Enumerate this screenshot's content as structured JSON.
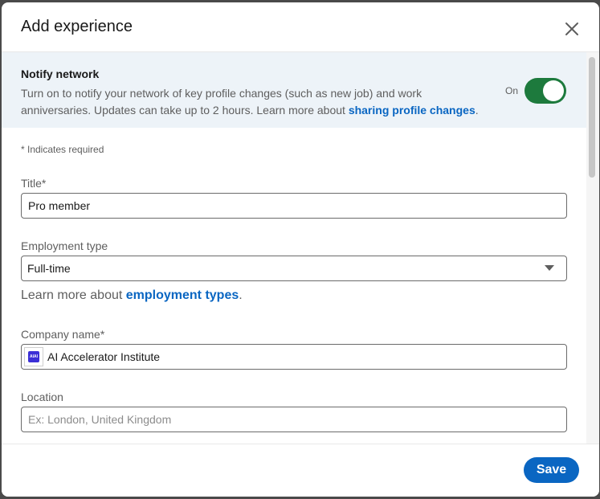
{
  "modal": {
    "title": "Add experience",
    "close_icon": "close-icon"
  },
  "notify": {
    "title": "Notify network",
    "description": "Turn on to notify your network of key profile changes (such as new job) and work anniversaries. Updates can take up to 2 hours. Learn more about ",
    "link_text": "sharing profile changes",
    "trailing": ".",
    "toggle_label": "On",
    "toggle_on": true,
    "toggle_color": "#1d7a3d"
  },
  "form": {
    "required_note": "* Indicates required",
    "title_label": "Title*",
    "title_value": "Pro member",
    "employment_label": "Employment type",
    "employment_value": "Full-time",
    "learn_prefix": "Learn more about ",
    "learn_link": "employment types",
    "learn_suffix": ".",
    "company_label": "Company name*",
    "company_value": "AI Accelerator Institute",
    "company_logo_text": "AIAI",
    "location_label": "Location",
    "location_placeholder": "Ex: London, United Kingdom"
  },
  "footer": {
    "save_label": "Save"
  },
  "colors": {
    "accent": "#0a66c2",
    "notify_bg": "#edf3f8"
  }
}
